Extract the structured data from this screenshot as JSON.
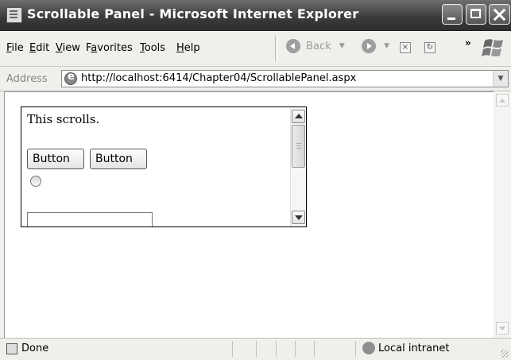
{
  "window": {
    "title": "Scrollable Panel - Microsoft Internet Explorer"
  },
  "menu": {
    "items": [
      "File",
      "Edit",
      "View",
      "Favorites",
      "Tools",
      "Help"
    ],
    "accel": [
      "F",
      "E",
      "V",
      "a",
      "T",
      "H"
    ]
  },
  "toolbar": {
    "back_label": "Back",
    "chevron": "»"
  },
  "address": {
    "label": "Address",
    "url": "http://localhost:6414/Chapter04/ScrollablePanel.aspx"
  },
  "panel": {
    "text": "This scrolls.",
    "button1_label": "Button",
    "button2_label": "Button"
  },
  "status": {
    "text": "Done",
    "zone": "Local intranet"
  }
}
